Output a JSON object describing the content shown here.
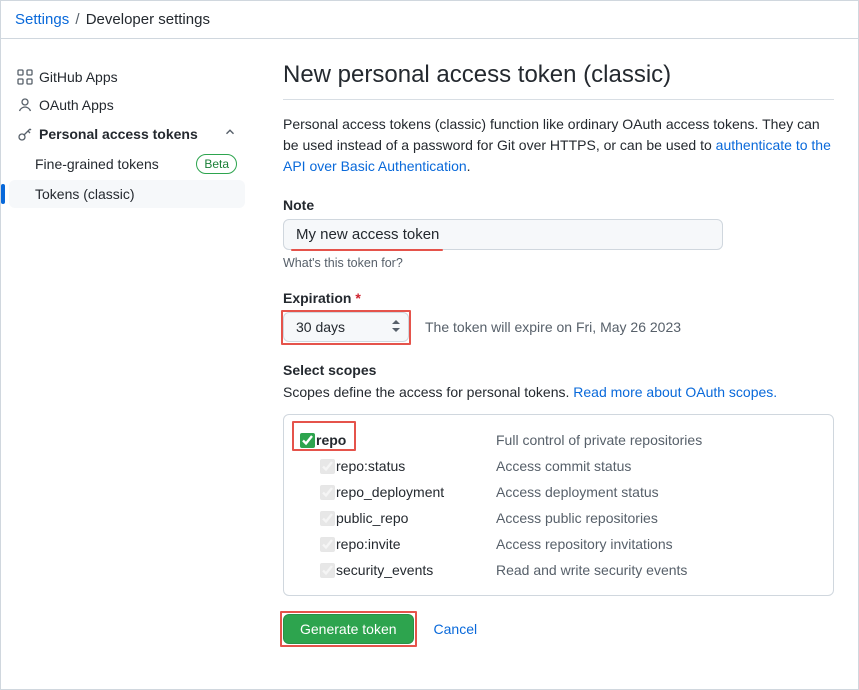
{
  "breadcrumb": {
    "settings": "Settings",
    "sep": "/",
    "current": "Developer settings"
  },
  "sidebar": {
    "github_apps": "GitHub Apps",
    "oauth_apps": "OAuth Apps",
    "pat": "Personal access tokens",
    "fine_grained": "Fine-grained tokens",
    "beta": "Beta",
    "tokens_classic": "Tokens (classic)"
  },
  "page": {
    "title": "New personal access token (classic)",
    "intro_1": "Personal access tokens (classic) function like ordinary OAuth access tokens. They can be used instead of a password for Git over HTTPS, or can be used to ",
    "intro_link": "authenticate to the API over Basic Authentication",
    "intro_2": "."
  },
  "note": {
    "label": "Note",
    "value": "My new access token",
    "hint": "What's this token for?"
  },
  "expiration": {
    "label": "Expiration",
    "selected": "30 days",
    "hint": "The token will expire on Fri, May 26 2023"
  },
  "scopes": {
    "label": "Select scopes",
    "desc_1": "Scopes define the access for personal tokens. ",
    "desc_link": "Read more about OAuth scopes.",
    "items": [
      {
        "name": "repo",
        "desc": "Full control of private repositories",
        "top": true,
        "checked": true
      },
      {
        "name": "repo:status",
        "desc": "Access commit status",
        "checked": true,
        "disabled": true
      },
      {
        "name": "repo_deployment",
        "desc": "Access deployment status",
        "checked": true,
        "disabled": true
      },
      {
        "name": "public_repo",
        "desc": "Access public repositories",
        "checked": true,
        "disabled": true
      },
      {
        "name": "repo:invite",
        "desc": "Access repository invitations",
        "checked": true,
        "disabled": true
      },
      {
        "name": "security_events",
        "desc": "Read and write security events",
        "checked": true,
        "disabled": true
      }
    ]
  },
  "actions": {
    "generate": "Generate token",
    "cancel": "Cancel"
  }
}
